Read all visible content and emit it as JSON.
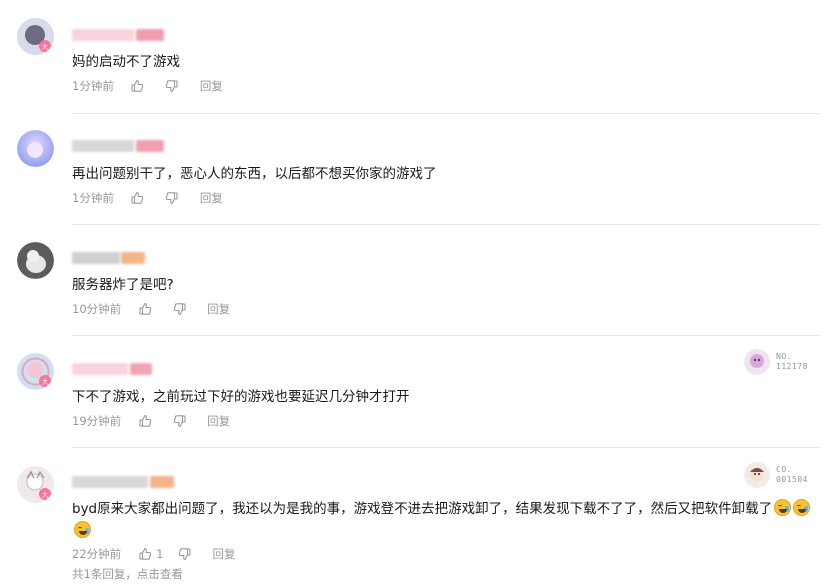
{
  "comments": [
    {
      "text": "妈的启动不了游戏",
      "time": "1分钟前",
      "reply_label": "回复",
      "avatar_color": "#c9cfe0",
      "name_colors": [
        "#f7d3dc",
        "#f19fb0"
      ]
    },
    {
      "text": "再出问题别干了，恶心人的东西，以后都不想买你家的游戏了",
      "time": "1分钟前",
      "reply_label": "回复",
      "avatar_color": "#b0b4f0",
      "name_colors": [
        "#dcdcdc",
        "#f19fb0"
      ]
    },
    {
      "text": "服务器炸了是吧?",
      "time": "10分钟前",
      "reply_label": "回复",
      "avatar_color": "#8a8a8a",
      "name_colors": [
        "#d0d0d0",
        "#f3b48b"
      ]
    },
    {
      "text": "下不了游戏，之前玩过下好的游戏也要延迟几分钟才打开",
      "time": "19分钟前",
      "reply_label": "回复",
      "avatar_color": "#c6d7ea",
      "name_colors": [
        "#f7d3dc",
        "#f1a4b4"
      ],
      "fan_badge": {
        "label": "NO.",
        "number": "112178",
        "color": "#d8a8d8"
      }
    },
    {
      "text": "byd原来大家都出问题了，我还以为是我的事，游戏登不进去把游戏卸了，结果发现下载不了了，然后又把软件卸载了",
      "time": "22分钟前",
      "like_count": "1",
      "reply_label": "回复",
      "avatar_color": "#e7dde2",
      "name_colors": [
        "#dcdcdc",
        "#f3b48b"
      ],
      "fan_badge": {
        "label": "CO.",
        "number": "001504",
        "color": "#cfc2b8"
      },
      "sub_replies": "共1条回复，点击查看"
    }
  ]
}
